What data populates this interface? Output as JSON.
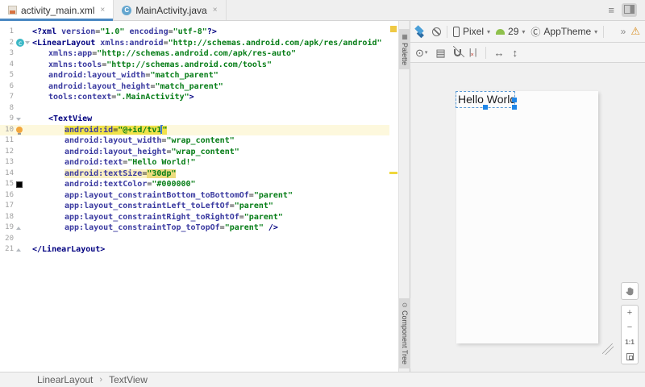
{
  "tabs": {
    "items": [
      {
        "label": "activity_main.xml",
        "active": true
      },
      {
        "label": "MainActivity.java",
        "active": false
      }
    ]
  },
  "icons": {
    "close": "×",
    "hamburger": "≡",
    "dropdown": "▾",
    "overflow": "»",
    "warning": "⚠",
    "eye": "⊙",
    "grid": "▤",
    "theme_c": "Ⓒ",
    "h_arrows": "↔",
    "v_arrows": "↕",
    "clear_x": "×",
    "palette_tab": "▦",
    "tree_tab": "⊙",
    "java_c": "C",
    "class_c": "c",
    "plus": "+",
    "minus": "−"
  },
  "tool_tabs": {
    "palette": "Palette",
    "component_tree": "Component Tree"
  },
  "design": {
    "toolbar": {
      "device": "Pixel",
      "api": "29",
      "theme": "AppTheme"
    },
    "preview": {
      "text": "Hello World!"
    },
    "zoom": {
      "ratio": "1:1"
    }
  },
  "breadcrumbs": {
    "items": [
      "LinearLayout",
      "TextView"
    ],
    "sep": "›"
  },
  "colors": {
    "accent_blue": "#4a88c2",
    "selection_blue": "#1f86e8",
    "highlight_yellow": "#f0e24a",
    "warning_orange": "#d98f23"
  },
  "editor": {
    "lines": [
      {
        "n": 1,
        "i": 0,
        "g": [],
        "s": [
          {
            "t": "<?xml ",
            "c": "g"
          },
          {
            "t": "version",
            "c": "a"
          },
          {
            "t": "=",
            "c": "p"
          },
          {
            "t": "\"1.0\"",
            "c": "v"
          },
          {
            "t": " ",
            "c": "p"
          },
          {
            "t": "encoding",
            "c": "a"
          },
          {
            "t": "=",
            "c": "p"
          },
          {
            "t": "\"utf-8\"",
            "c": "v"
          },
          {
            "t": "?>",
            "c": "g"
          }
        ]
      },
      {
        "n": 2,
        "i": 0,
        "g": [
          "cls",
          "fd"
        ],
        "s": [
          {
            "t": "<LinearLayout ",
            "c": "g"
          },
          {
            "t": "xmlns:android",
            "c": "a"
          },
          {
            "t": "=",
            "c": "p"
          },
          {
            "t": "\"http://schemas.android.com/apk/res/android\"",
            "c": "v"
          }
        ]
      },
      {
        "n": 3,
        "i": 1,
        "g": [],
        "s": [
          {
            "t": "xmlns:app",
            "c": "a"
          },
          {
            "t": "=",
            "c": "p"
          },
          {
            "t": "\"http://schemas.android.com/apk/res-auto\"",
            "c": "v"
          }
        ]
      },
      {
        "n": 4,
        "i": 1,
        "g": [],
        "s": [
          {
            "t": "xmlns:tools",
            "c": "a"
          },
          {
            "t": "=",
            "c": "p"
          },
          {
            "t": "\"http://schemas.android.com/tools\"",
            "c": "v"
          }
        ]
      },
      {
        "n": 5,
        "i": 1,
        "g": [],
        "s": [
          {
            "t": "android:layout_width",
            "c": "a"
          },
          {
            "t": "=",
            "c": "p"
          },
          {
            "t": "\"match_parent\"",
            "c": "v"
          }
        ]
      },
      {
        "n": 6,
        "i": 1,
        "g": [],
        "s": [
          {
            "t": "android:layout_height",
            "c": "a"
          },
          {
            "t": "=",
            "c": "p"
          },
          {
            "t": "\"match_parent\"",
            "c": "v"
          }
        ]
      },
      {
        "n": 7,
        "i": 1,
        "g": [],
        "s": [
          {
            "t": "tools:context",
            "c": "a"
          },
          {
            "t": "=",
            "c": "p"
          },
          {
            "t": "\".MainActivity\"",
            "c": "v"
          },
          {
            "t": ">",
            "c": "g"
          }
        ]
      },
      {
        "n": 8,
        "i": 0,
        "g": [],
        "s": []
      },
      {
        "n": 9,
        "i": 1,
        "g": [
          "fd"
        ],
        "s": [
          {
            "t": "<TextView",
            "c": "g"
          }
        ]
      },
      {
        "n": 10,
        "i": 2,
        "g": [
          "bulb"
        ],
        "cr": true,
        "s": [
          {
            "t": "android:id",
            "c": "a",
            "b": "h"
          },
          {
            "t": "=",
            "c": "p",
            "b": "h"
          },
          {
            "t": "\"@+id/tv1",
            "c": "v",
            "b": "h"
          },
          {
            "caret": true
          },
          {
            "t": "\"",
            "c": "v",
            "b": "h"
          }
        ]
      },
      {
        "n": 11,
        "i": 2,
        "g": [],
        "s": [
          {
            "t": "android:layout_width",
            "c": "a"
          },
          {
            "t": "=",
            "c": "p"
          },
          {
            "t": "\"wrap_content\"",
            "c": "v"
          }
        ]
      },
      {
        "n": 12,
        "i": 2,
        "g": [],
        "s": [
          {
            "t": "android:layout_height",
            "c": "a"
          },
          {
            "t": "=",
            "c": "p"
          },
          {
            "t": "\"wrap_content\"",
            "c": "v"
          }
        ]
      },
      {
        "n": 13,
        "i": 2,
        "g": [],
        "s": [
          {
            "t": "android:text",
            "c": "a"
          },
          {
            "t": "=",
            "c": "p"
          },
          {
            "t": "\"Hello World!\"",
            "c": "v"
          }
        ]
      },
      {
        "n": 14,
        "i": 2,
        "g": [],
        "s": [
          {
            "t": "android:textSize",
            "c": "a",
            "b": "w"
          },
          {
            "t": "=",
            "c": "p",
            "b": "w"
          },
          {
            "t": "\"30dp\"",
            "c": "v",
            "b": "w2"
          }
        ]
      },
      {
        "n": 15,
        "i": 2,
        "g": [
          "blk"
        ],
        "s": [
          {
            "t": "android:textColor",
            "c": "a"
          },
          {
            "t": "=",
            "c": "p"
          },
          {
            "t": "\"#000000\"",
            "c": "v"
          }
        ]
      },
      {
        "n": 16,
        "i": 2,
        "g": [],
        "s": [
          {
            "t": "app:layout_constraintBottom_toBottomOf",
            "c": "a"
          },
          {
            "t": "=",
            "c": "p"
          },
          {
            "t": "\"parent\"",
            "c": "v"
          }
        ]
      },
      {
        "n": 17,
        "i": 2,
        "g": [],
        "s": [
          {
            "t": "app:layout_constraintLeft_toLeftOf",
            "c": "a"
          },
          {
            "t": "=",
            "c": "p"
          },
          {
            "t": "\"parent\"",
            "c": "v"
          }
        ]
      },
      {
        "n": 18,
        "i": 2,
        "g": [],
        "s": [
          {
            "t": "app:layout_constraintRight_toRightOf",
            "c": "a"
          },
          {
            "t": "=",
            "c": "p"
          },
          {
            "t": "\"parent\"",
            "c": "v"
          }
        ]
      },
      {
        "n": 19,
        "i": 2,
        "g": [
          "fu"
        ],
        "s": [
          {
            "t": "app:layout_constraintTop_toTopOf",
            "c": "a"
          },
          {
            "t": "=",
            "c": "p"
          },
          {
            "t": "\"parent\"",
            "c": "v"
          },
          {
            "t": " ",
            "c": "p"
          },
          {
            "t": "/>",
            "c": "g"
          }
        ]
      },
      {
        "n": 20,
        "i": 0,
        "g": [],
        "s": []
      },
      {
        "n": 21,
        "i": 0,
        "g": [
          "fu"
        ],
        "s": [
          {
            "t": "</LinearLayout>",
            "c": "g"
          }
        ]
      }
    ]
  }
}
